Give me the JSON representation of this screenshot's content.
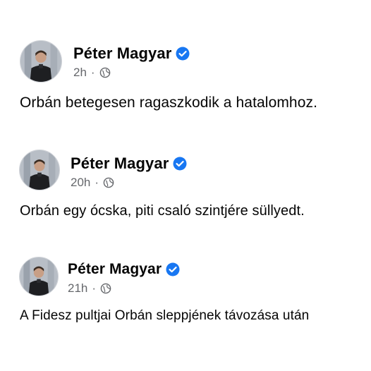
{
  "posts": [
    {
      "author": "Péter Magyar",
      "time": "2h",
      "separator": "·",
      "verified_icon": "verified-badge-icon",
      "privacy_icon": "globe-icon",
      "text": "Orbán betegesen ragaszkodik a hatalomhoz."
    },
    {
      "author": "Péter Magyar",
      "time": "20h",
      "separator": "·",
      "verified_icon": "verified-badge-icon",
      "privacy_icon": "globe-icon",
      "text": "Orbán egy ócska, piti csaló szintjére süllyedt."
    },
    {
      "author": "Péter Magyar",
      "time": "21h",
      "separator": "·",
      "verified_icon": "verified-badge-icon",
      "privacy_icon": "globe-icon",
      "text": "A Fidesz pultjai Orbán sleppjének távozása után"
    }
  ],
  "colors": {
    "name": "#050505",
    "meta": "#65676b",
    "verified": "#1877f2",
    "text": "#050505"
  }
}
